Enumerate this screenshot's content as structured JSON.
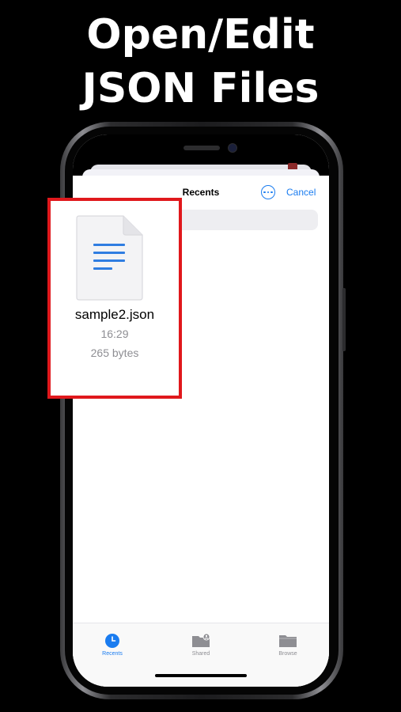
{
  "headline": {
    "line1": "Open/Edit",
    "line2": "JSON Files"
  },
  "nav": {
    "title": "Recents",
    "cancel_label": "Cancel"
  },
  "file": {
    "name": "sample2.json",
    "time": "16:29",
    "size": "265 bytes"
  },
  "tabs": [
    {
      "label": "Recents",
      "icon": "clock-icon",
      "active": true
    },
    {
      "label": "Shared",
      "icon": "shared-folder-icon",
      "active": false
    },
    {
      "label": "Browse",
      "icon": "folder-icon",
      "active": false
    }
  ],
  "colors": {
    "accent": "#1a7cf0",
    "highlight_border": "#e0181c",
    "background": "#000000"
  }
}
